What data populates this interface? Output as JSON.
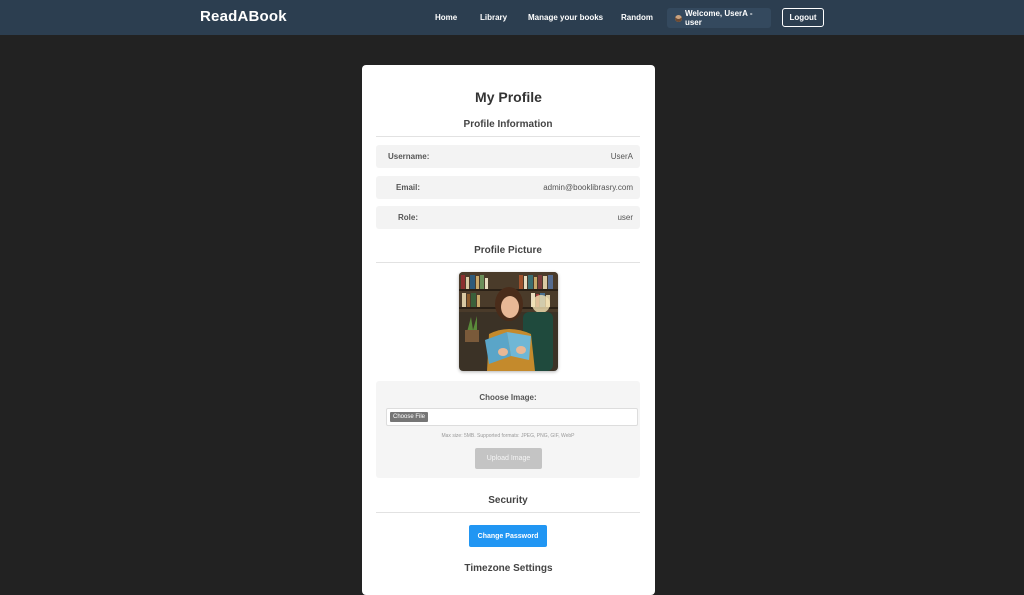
{
  "navbar": {
    "brand": "ReadABook",
    "links": [
      "Home",
      "Library",
      "Manage your books",
      "Random"
    ],
    "welcome": "Welcome, UserA - user",
    "logout": "Logout"
  },
  "profile": {
    "title": "My Profile",
    "info_section": "Profile Information",
    "fields": [
      {
        "label": "Username:",
        "value": "UserA"
      },
      {
        "label": "Email:",
        "value": "admin@booklibrasry.com"
      },
      {
        "label": "Role:",
        "value": "user"
      }
    ],
    "picture_section": "Profile Picture",
    "choose_image_label": "Choose Image:",
    "choose_file_button": "Choose File",
    "hint": "Max size: 5MB. Supported formats: JPEG, PNG, GIF, WebP",
    "upload_button": "Upload Image",
    "security_section": "Security",
    "change_password_button": "Change Password",
    "timezone_section": "Timezone Settings"
  },
  "colors": {
    "navbar": "#2c3e50",
    "background": "#222222",
    "primary_button": "#2196f3",
    "disabled_button": "#c4c4c4"
  }
}
